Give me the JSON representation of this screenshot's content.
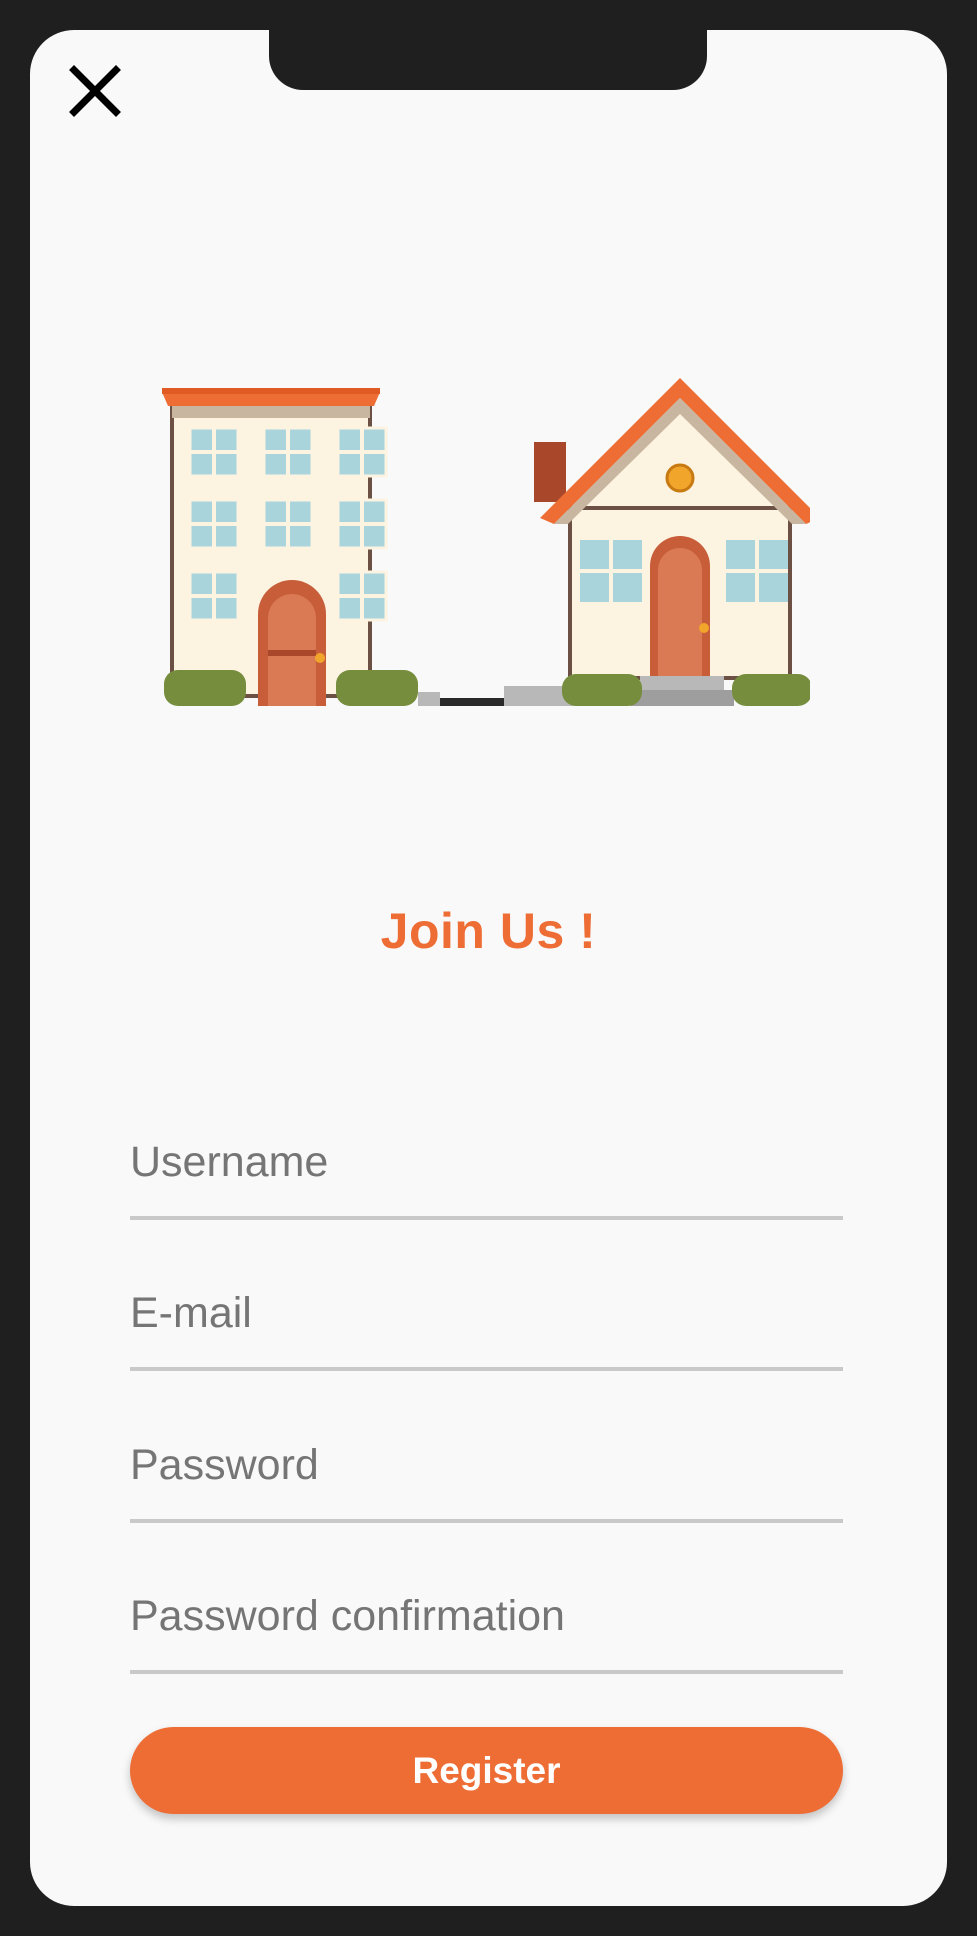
{
  "header": {
    "close_icon": "close-icon"
  },
  "illustration": {
    "icon": "houses-illustration"
  },
  "title": "Join Us !",
  "form": {
    "username_placeholder": "Username",
    "email_placeholder": "E-mail",
    "password_placeholder": "Password",
    "password_confirmation_placeholder": "Password confirmation",
    "register_label": "Register"
  },
  "colors": {
    "accent": "#ed6d35",
    "background": "#f9f9f9",
    "frame": "#1f1f1f",
    "divider": "#c9c9c9",
    "placeholder": "#757575"
  }
}
